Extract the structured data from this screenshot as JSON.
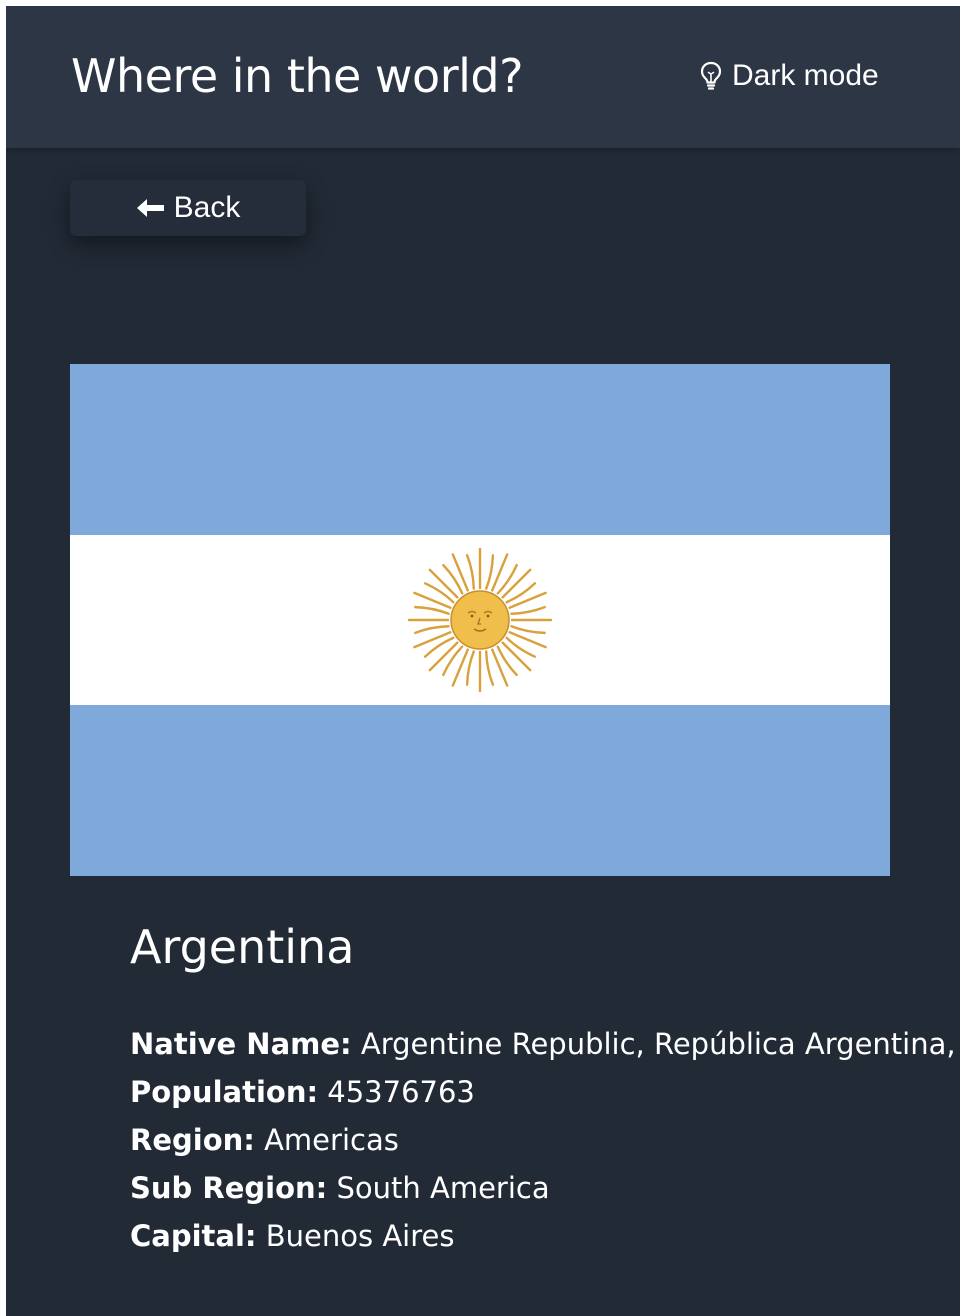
{
  "header": {
    "title": "Where in the world?",
    "theme_toggle_label": "Dark mode",
    "theme_toggle_icon": "lightbulb-icon"
  },
  "back_button": {
    "label": "Back",
    "icon": "arrow-left-icon"
  },
  "country": {
    "name": "Argentina",
    "flag": {
      "name": "flag-argentina",
      "colors": {
        "blue": "#7fa9db",
        "white": "#ffffff",
        "sun": "#f0be4a",
        "sun_rays": "#d9a13a"
      }
    },
    "facts": [
      {
        "key": "Native Name:",
        "value": "Argentine Republic, República Argentina,"
      },
      {
        "key": "Population:",
        "value": "45376763"
      },
      {
        "key": "Region:",
        "value": "Americas"
      },
      {
        "key": "Sub Region:",
        "value": "South America"
      },
      {
        "key": "Capital:",
        "value": "Buenos Aires"
      }
    ]
  },
  "colors": {
    "background": "#222a36",
    "header": "#2c3644",
    "text": "#ffffff"
  }
}
